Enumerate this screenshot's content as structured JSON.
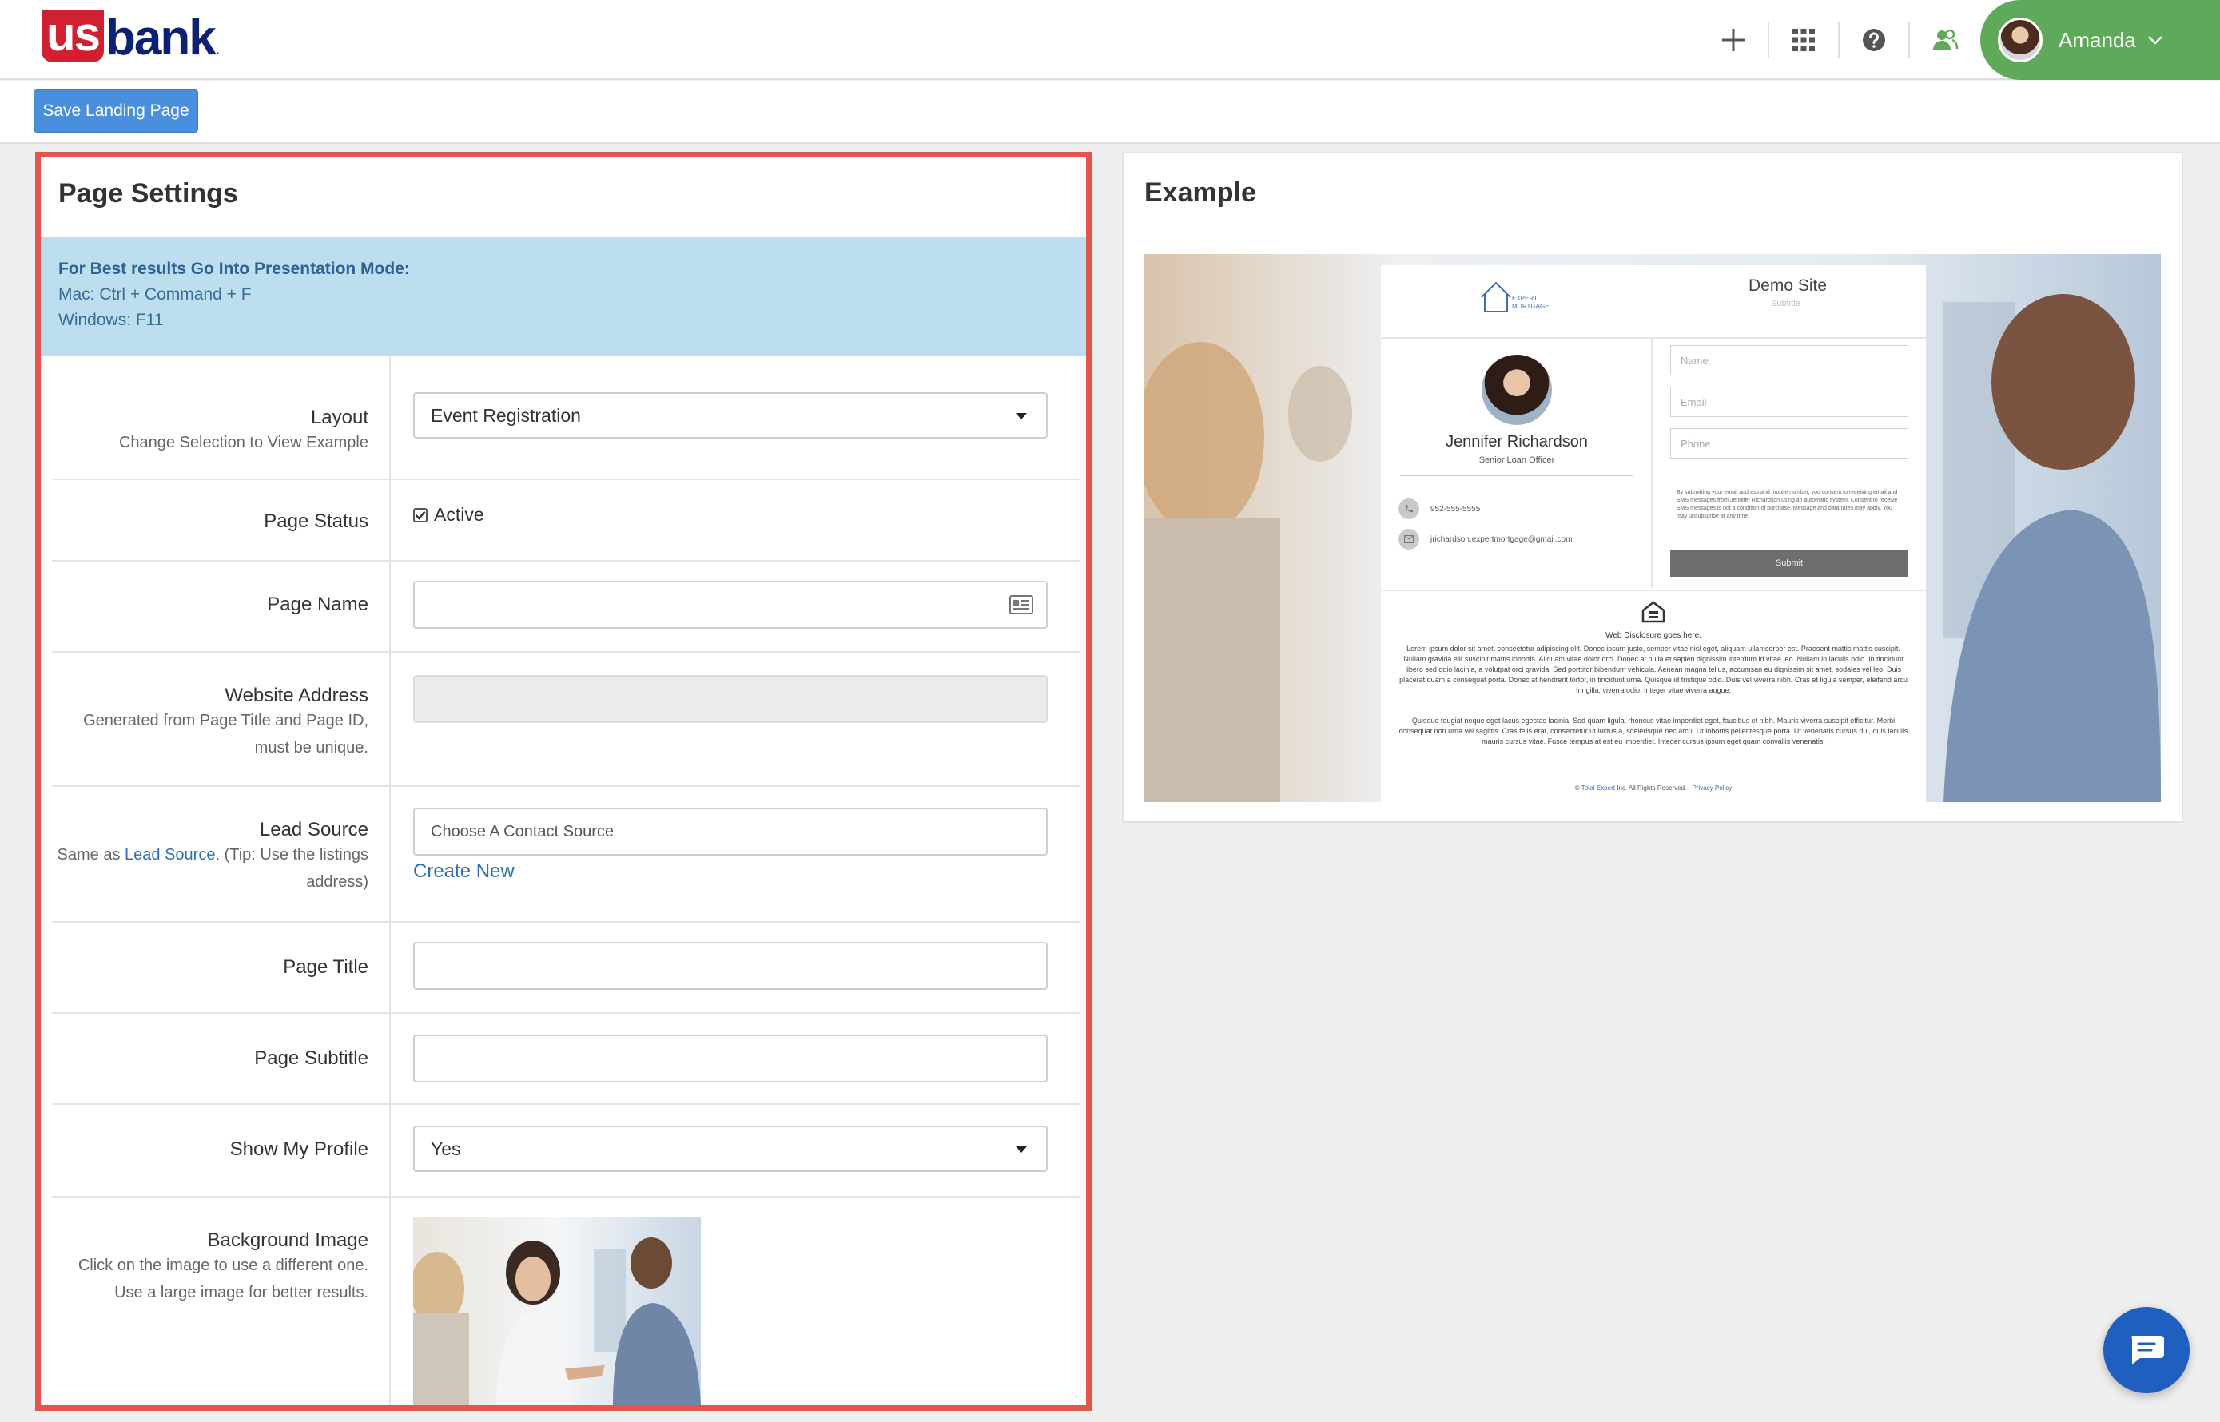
{
  "brand": {
    "logo_us": "us",
    "logo_bank": "bank",
    "logo_dot": "."
  },
  "header": {
    "icons": [
      "plus-icon",
      "grid-icon",
      "help-icon",
      "people-icon"
    ],
    "user_name": "Amanda"
  },
  "toolbar": {
    "save_label": "Save Landing Page"
  },
  "settings": {
    "title": "Page Settings",
    "notice": {
      "title": "For Best results Go Into Presentation Mode:",
      "mac": "Mac: Ctrl + Command + F",
      "windows": "Windows: F11"
    },
    "layout": {
      "label": "Layout",
      "sub": "Change Selection to View Example",
      "value": "Event Registration"
    },
    "page_status": {
      "label": "Page Status",
      "checkbox_label": "Active",
      "checked": true
    },
    "page_name": {
      "label": "Page Name",
      "value": ""
    },
    "website_address": {
      "label": "Website Address",
      "sub1": "Generated from Page Title and Page ID,",
      "sub2": "must be unique."
    },
    "lead_source": {
      "label": "Lead Source",
      "sub_prefix": "Same as ",
      "sub_link": "Lead Source",
      "sub_suffix": ". (Tip: Use the listings",
      "sub2": "address)",
      "placeholder": "Choose A Contact Source",
      "create_new": "Create New"
    },
    "page_title": {
      "label": "Page Title",
      "value": ""
    },
    "page_subtitle": {
      "label": "Page Subtitle",
      "value": ""
    },
    "show_profile": {
      "label": "Show My Profile",
      "value": "Yes"
    },
    "background_image": {
      "label": "Background Image",
      "sub1": "Click on the image to use a different one.",
      "sub2": "Use a large image for better results."
    }
  },
  "example": {
    "title": "Example",
    "demo": {
      "site_title": "Demo Site",
      "subtitle": "Subtitle",
      "logo_line1": "EXPERT",
      "logo_line2": "MORTGAGE",
      "profile_name": "Jennifer Richardson",
      "profile_title": "Senior Loan Officer",
      "phone": "952-555-5555",
      "email": "jrichardson.expertmortgage@gmail.com",
      "fields": [
        "Name",
        "Email",
        "Phone"
      ],
      "legal": "By submitting your email address and mobile number, you consent to receiving email and SMS messages from Jennifer Richardson using an automatic system. Consent to receive SMS messages is not a condition of purchase. Message and data rates may apply. You may unsubscribe at any time.",
      "submit": "Submit",
      "disclosure_title": "Web Disclosure goes here.",
      "disclosure_p1": "Lorem ipsum dolor sit amet, consectetur adipiscing elit. Donec ipsum justo, semper vitae nisl eget, aliquam ullamcorper est. Praesent mattis mattis suscipit. Nullam gravida elit suscipit mattis lobortis. Aliquam vitae dolor orci. Donec at nulla et sapien dignissim interdum id vitae leo. Nullam in iaculis odio. In tincidunt libero sed odio lacinia, a volutpat orci gravida. Sed porttitor bibendum vehicula. Aenean magna tellus, accumsan eu dignissim sit amet, sodales vel leo. Duis placerat quam a consequat porta. Donec at hendrerit tortor, in tincidunt urna. Quisque id tristique odio. Duis vel viverra nibh. Cras et ligula semper, eleifend arcu fringilla, viverra odio. Integer vitae viverra augue.",
      "disclosure_p2": "Quisque feugiat neque eget lacus egestas lacinia. Sed quam ligula, rhoncus vitae imperdiet eget, faucibus et nibh. Mauris viverra suscipit efficitur. Morbi consequat non urna vel sagittis. Cras felis erat, consectetur ut luctus a, scelerisque nec arcu. Ut lobortis pellentesque porta. Ut venenatis cursus dui, quis iaculis mauris cursus vitae. Fusce tempus at est eu imperdiet. Integer cursus ipsum eget quam convallis venenatis.",
      "footer_prefix": "© ",
      "footer_link1": "Total Expert",
      "footer_mid": " Inc. All Rights Reserved. - ",
      "footer_link2": "Privacy Policy"
    }
  },
  "colors": {
    "brand_red": "#d12030",
    "brand_navy": "#0c2074",
    "accent_blue": "#4a8fde",
    "user_green": "#5eaa5a",
    "highlight_red": "#e2564d",
    "notice_blue": "#bcdeee"
  }
}
